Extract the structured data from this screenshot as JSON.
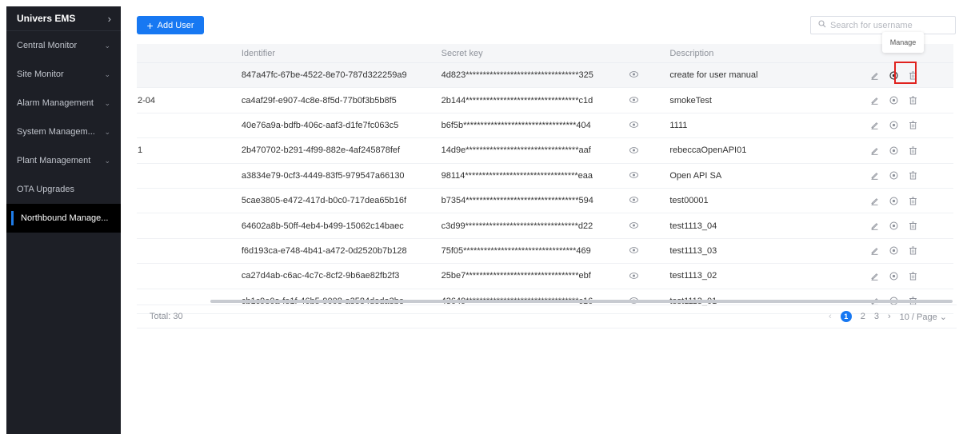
{
  "sidebar": {
    "app_title": "Univers EMS",
    "items": [
      {
        "label": "Central Monitor",
        "has_arrow": true
      },
      {
        "label": "Site Monitor",
        "has_arrow": true
      },
      {
        "label": "Alarm Management",
        "has_arrow": true
      },
      {
        "label": "System Managem...",
        "has_arrow": true
      },
      {
        "label": "Plant Management",
        "has_arrow": true
      },
      {
        "label": "OTA Upgrades",
        "has_arrow": false
      },
      {
        "label": "Northbound Manage...",
        "has_arrow": false,
        "active": true
      }
    ]
  },
  "toolbar": {
    "add_user_label": "Add User",
    "search_placeholder": "Search for username"
  },
  "table": {
    "headers": {
      "identifier": "Identifier",
      "secret_key": "Secret key",
      "description": "Description"
    },
    "rows": [
      {
        "prefix": "",
        "identifier": "847a47fc-67be-4522-8e70-787d322259a9",
        "secret": "4d823*********************************325",
        "description": "create for user manual"
      },
      {
        "prefix": "2-04",
        "identifier": "ca4af29f-e907-4c8e-8f5d-77b0f3b5b8f5",
        "secret": "2b144*********************************c1d",
        "description": "smokeTest"
      },
      {
        "prefix": "",
        "identifier": "40e76a9a-bdfb-406c-aaf3-d1fe7fc063c5",
        "secret": "b6f5b*********************************404",
        "description": "1111"
      },
      {
        "prefix": "1",
        "identifier": "2b470702-b291-4f99-882e-4af245878fef",
        "secret": "14d9e*********************************aaf",
        "description": "rebeccaOpenAPI01"
      },
      {
        "prefix": "",
        "identifier": "a3834e79-0cf3-4449-83f5-979547a66130",
        "secret": "98114*********************************eaa",
        "description": "Open API SA"
      },
      {
        "prefix": "",
        "identifier": "5cae3805-e472-417d-b0c0-717dea65b16f",
        "secret": "b7354*********************************594",
        "description": "test00001"
      },
      {
        "prefix": "",
        "identifier": "64602a8b-50ff-4eb4-b499-15062c14baec",
        "secret": "c3d99*********************************d22",
        "description": "test1113_04"
      },
      {
        "prefix": "",
        "identifier": "f6d193ca-e748-4b41-a472-0d2520b7b128",
        "secret": "75f05*********************************469",
        "description": "test1113_03"
      },
      {
        "prefix": "",
        "identifier": "ca27d4ab-c6ac-4c7c-8cf2-9b6ae82fb2f3",
        "secret": "25be7*********************************ebf",
        "description": "test1113_02"
      },
      {
        "prefix": "",
        "identifier": "cb1c9e0a-fe1f-46b5-9008-a3584deda3be",
        "secret": "43649*********************************c16",
        "description": "test1113_01"
      }
    ]
  },
  "tooltip": {
    "text": "Manage"
  },
  "footer": {
    "total": "Total: 30",
    "pages": [
      "1",
      "2",
      "3"
    ],
    "current_page": "1",
    "page_size": "10 / Page"
  },
  "colors": {
    "accent": "#1778f2",
    "sidebar_bg": "#1d1f26",
    "highlight": "#e0221e"
  }
}
